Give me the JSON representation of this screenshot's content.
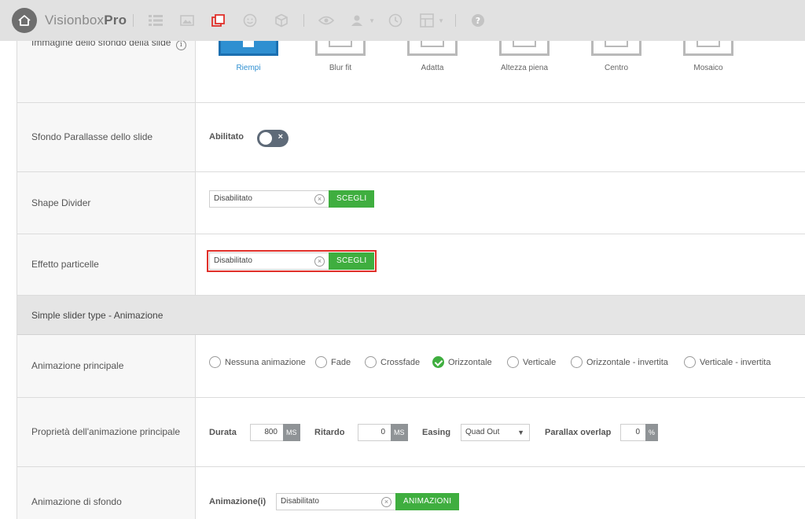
{
  "app": {
    "brand_light": "Visionbox",
    "brand_bold": "Pro"
  },
  "toolbar_icons": [
    "list-icon",
    "image-gallery-icon",
    "layers-icon",
    "smiley-icon",
    "cube-icon",
    "eye-icon",
    "users-icon",
    "clock-icon",
    "grid-icon",
    "help-icon"
  ],
  "rows": {
    "bg_image": {
      "label": "Immagine dello sfondo della slide",
      "options": [
        {
          "label": "Riempi",
          "active": true
        },
        {
          "label": "Blur fit",
          "active": false
        },
        {
          "label": "Adatta",
          "active": false
        },
        {
          "label": "Altezza piena",
          "active": false
        },
        {
          "label": "Centro",
          "active": false
        },
        {
          "label": "Mosaico",
          "active": false
        }
      ]
    },
    "parallax": {
      "label": "Sfondo Parallasse dello slide",
      "field_label": "Abilitato",
      "toggle_icon": "×"
    },
    "shape_divider": {
      "label": "Shape Divider",
      "value": "Disabilitato",
      "button": "SCEGLI"
    },
    "particles": {
      "label": "Effetto particelle",
      "value": "Disabilitato",
      "button": "SCEGLI"
    },
    "section": {
      "title": "Simple slider type - Animazione"
    },
    "main_anim": {
      "label": "Animazione principale",
      "options": [
        {
          "label": "Nessuna animazione",
          "checked": false
        },
        {
          "label": "Fade",
          "checked": false
        },
        {
          "label": "Crossfade",
          "checked": false
        },
        {
          "label": "Orizzontale",
          "checked": true
        },
        {
          "label": "Verticale",
          "checked": false
        },
        {
          "label": "Orizzontale - invertita",
          "checked": false
        },
        {
          "label": "Verticale - invertita",
          "checked": false
        }
      ]
    },
    "anim_props": {
      "label": "Proprietà dell'animazione principale",
      "duration_label": "Durata",
      "duration_value": "800",
      "duration_unit": "MS",
      "delay_label": "Ritardo",
      "delay_value": "0",
      "delay_unit": "MS",
      "easing_label": "Easing",
      "easing_value": "Quad Out",
      "parallax_label": "Parallax overlap",
      "parallax_value": "0",
      "parallax_unit": "%"
    },
    "bg_anim": {
      "label": "Animazione di sfondo",
      "field_label": "Animazione(i)",
      "value": "Disabilitato",
      "button": "ANIMAZIONI"
    }
  },
  "colors": {
    "accent_blue": "#2f8fd1",
    "button_green": "#3fae3f",
    "highlight_red": "#e0302a",
    "toggle_off": "#5e6a78"
  }
}
